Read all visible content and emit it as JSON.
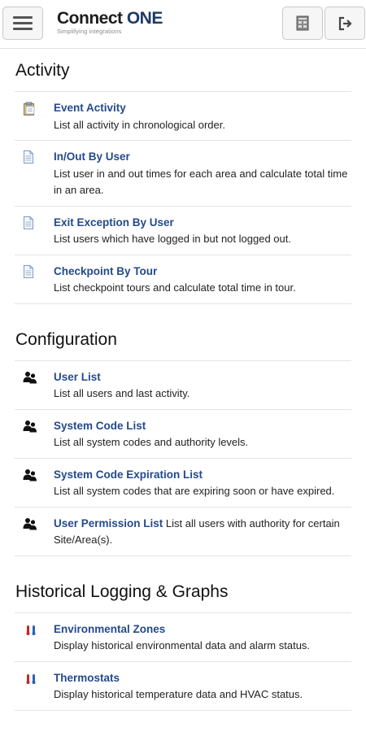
{
  "header": {
    "logo_main": "Connect ",
    "logo_accent": "ONE",
    "logo_tagline": "Simplifying integrations"
  },
  "sections": {
    "activity": {
      "title": "Activity",
      "items": [
        {
          "label": "Event Activity",
          "desc": "List all activity in chronological order."
        },
        {
          "label": "In/Out By User",
          "desc": "List user in and out times for each area and calculate total time in an area."
        },
        {
          "label": "Exit Exception By User",
          "desc": "List users which have logged in but not logged out."
        },
        {
          "label": "Checkpoint By Tour",
          "desc": "List checkpoint tours and calculate total time in tour."
        }
      ]
    },
    "configuration": {
      "title": "Configuration",
      "items": [
        {
          "label": "User List",
          "desc": "List all users and last activity."
        },
        {
          "label": "System Code List",
          "desc": "List all system codes and authority levels."
        },
        {
          "label": "System Code Expiration List",
          "desc": "List all system codes that are expiring soon or have expired."
        },
        {
          "label": "User Permission List",
          "desc": " List all users with authority for certain Site/Area(s)."
        }
      ]
    },
    "historical": {
      "title": "Historical Logging & Graphs",
      "items": [
        {
          "label": "Environmental Zones",
          "desc": "Display historical environmental data and alarm status."
        },
        {
          "label": "Thermostats",
          "desc": "Display historical temperature data and HVAC status."
        }
      ]
    }
  },
  "icons": {
    "clipboard": "clipboard-icon",
    "document": "document-icon",
    "users": "users-icon",
    "thermometer": "thermometer-icon"
  },
  "colors": {
    "link": "#244a8b",
    "therm_hot": "#c62828",
    "therm_cold": "#2962b8"
  }
}
